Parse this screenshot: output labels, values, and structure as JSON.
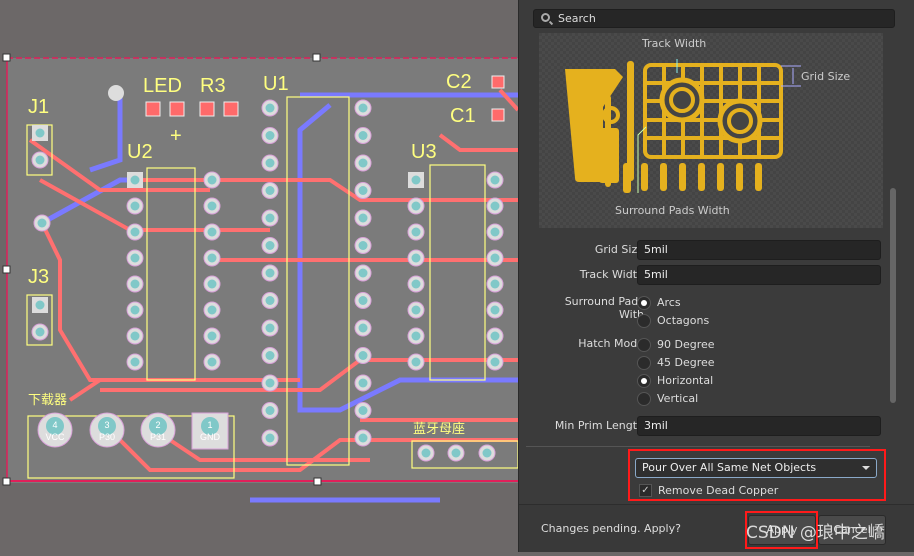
{
  "pcb": {
    "designators": {
      "led": "LED",
      "r3": "R3",
      "u1": "U1",
      "c2": "C2",
      "c1": "C1",
      "j1": "J1",
      "u2": "U2",
      "u3": "U3",
      "j3": "J3",
      "plus": "+"
    },
    "downloader_label": "下载器",
    "bluetooth_label": "蓝牙母座",
    "header_pins": [
      {
        "num": "4",
        "name": "VCC"
      },
      {
        "num": "3",
        "name": "P30"
      },
      {
        "num": "2",
        "name": "P31"
      },
      {
        "num": "1",
        "name": "GND"
      }
    ],
    "colors": {
      "top_layer": "#ff7070",
      "bottom_layer": "#7a7aff",
      "silkscreen": "#ffff80",
      "pad": "#80c8c8",
      "selection": "#e0205a"
    }
  },
  "panel": {
    "search_placeholder": "Search",
    "preview": {
      "track_width": "Track Width",
      "grid_size": "Grid Size",
      "surround_pads_width": "Surround Pads Width",
      "copper_color": "#e5b11e"
    },
    "grid_size": {
      "label": "Grid Size",
      "value": "5mil"
    },
    "track_width": {
      "label": "Track Width",
      "value": "5mil"
    },
    "surround_pads": {
      "label": "Surround Pads With",
      "options": [
        "Arcs",
        "Octagons"
      ],
      "selected": "Arcs"
    },
    "hatch_mode": {
      "label": "Hatch Mode",
      "options": [
        "90 Degree",
        "45 Degree",
        "Horizontal",
        "Vertical"
      ],
      "selected": "Horizontal"
    },
    "min_prim_length": {
      "label": "Min Prim Length",
      "value": "3mil"
    },
    "pour_mode": {
      "value": "Pour Over All Same Net Objects"
    },
    "remove_dead_copper": {
      "label": "Remove Dead Copper",
      "checked": true
    },
    "footer": {
      "pending": "Changes pending. Apply?",
      "apply": "Apply",
      "cancel": "Cancel"
    }
  },
  "watermark": "CSDN @琅中之嶠"
}
